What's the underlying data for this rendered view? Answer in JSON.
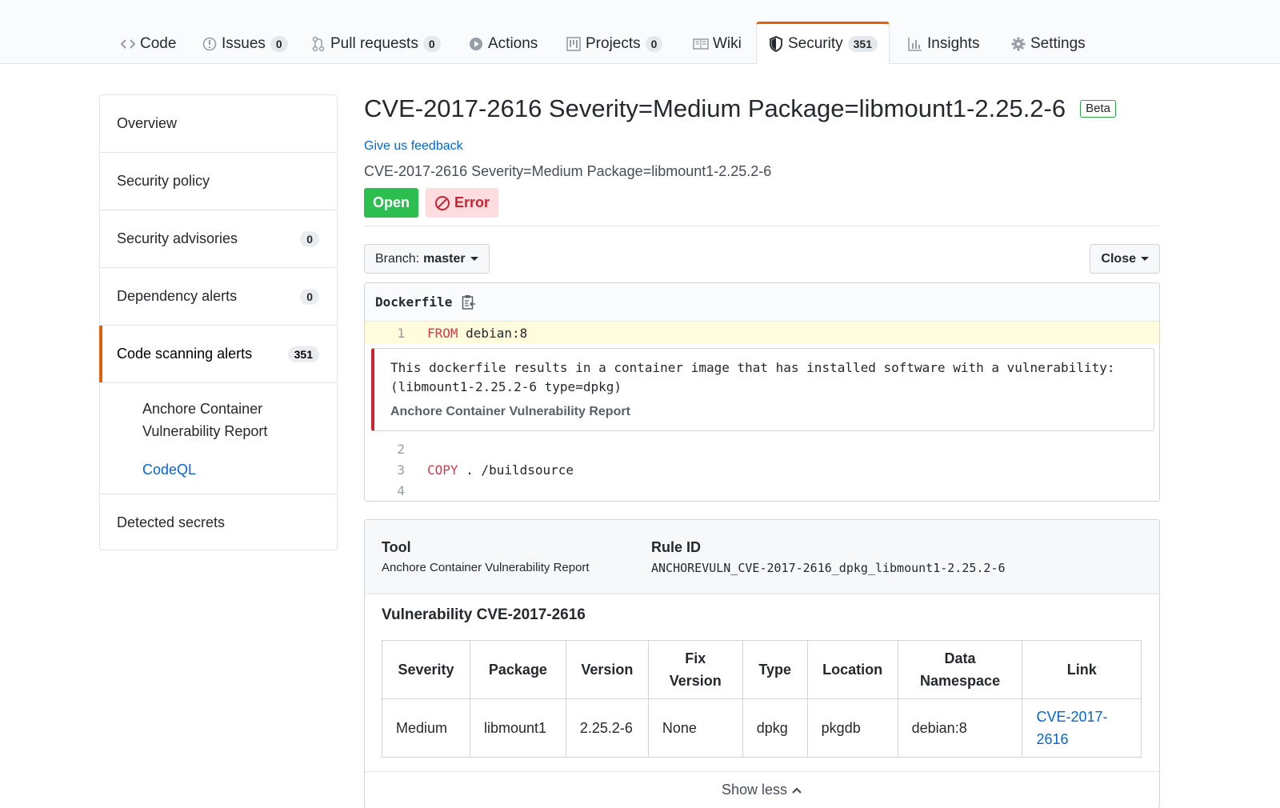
{
  "nav": {
    "tabs": [
      {
        "label": "Code",
        "count": null,
        "icon": "code-icon"
      },
      {
        "label": "Issues",
        "count": "0",
        "icon": "issue-icon"
      },
      {
        "label": "Pull requests",
        "count": "0",
        "icon": "pull-request-icon"
      },
      {
        "label": "Actions",
        "count": null,
        "icon": "play-icon"
      },
      {
        "label": "Projects",
        "count": "0",
        "icon": "project-icon"
      },
      {
        "label": "Wiki",
        "count": null,
        "icon": "book-icon"
      },
      {
        "label": "Security",
        "count": "351",
        "icon": "shield-icon",
        "active": true
      },
      {
        "label": "Insights",
        "count": null,
        "icon": "graph-icon"
      },
      {
        "label": "Settings",
        "count": null,
        "icon": "gear-icon"
      }
    ],
    "accent": "#e36209"
  },
  "sidebar": {
    "items": [
      {
        "label": "Overview",
        "count": null
      },
      {
        "label": "Security policy",
        "count": null
      },
      {
        "label": "Security advisories",
        "count": "0"
      },
      {
        "label": "Dependency alerts",
        "count": "0"
      },
      {
        "label": "Code scanning alerts",
        "count": "351",
        "selected": true
      },
      {
        "label": "Detected secrets",
        "count": null
      }
    ],
    "subitems": [
      {
        "label": "Anchore Container Vulnerability Report"
      },
      {
        "label": "CodeQL"
      }
    ]
  },
  "alert": {
    "title": "CVE-2017-2616 Severity=Medium Package=libmount1-2.25.2-6",
    "beta_label": "Beta",
    "feedback_link": "Give us feedback",
    "subtitle": "CVE-2017-2616 Severity=Medium Package=libmount1-2.25.2-6",
    "status_open": "Open",
    "status_error": "Error"
  },
  "controls": {
    "branch_prefix": "Branch:",
    "branch_name": "master",
    "close_label": "Close"
  },
  "code": {
    "filename": "Dockerfile",
    "lines": [
      {
        "num": "1",
        "keyword": "FROM",
        "rest": " debian:8"
      },
      {
        "num": "2",
        "keyword": "",
        "rest": ""
      },
      {
        "num": "3",
        "keyword": "COPY",
        "rest": " . /buildsource"
      },
      {
        "num": "4",
        "keyword": "",
        "rest": ""
      }
    ],
    "alert_message": "This dockerfile results in a container image that has installed software with a vulnerability:\n(libmount1-2.25.2-6 type=dpkg)",
    "alert_source": "Anchore Container Vulnerability Report"
  },
  "details": {
    "tool_label": "Tool",
    "tool_value": "Anchore Container Vulnerability Report",
    "rule_label": "Rule ID",
    "rule_value": "ANCHOREVULN_CVE-2017-2616_dpkg_libmount1-2.25.2-6",
    "vuln_title": "Vulnerability CVE-2017-2616",
    "table": {
      "headers": [
        "Severity",
        "Package",
        "Version",
        "Fix Version",
        "Type",
        "Location",
        "Data Namespace",
        "Link"
      ],
      "row": [
        "Medium",
        "libmount1",
        "2.25.2-6",
        "None",
        "dpkg",
        "pkgdb",
        "debian:8",
        "CVE-2017-2616"
      ]
    },
    "show_less": "Show less"
  }
}
